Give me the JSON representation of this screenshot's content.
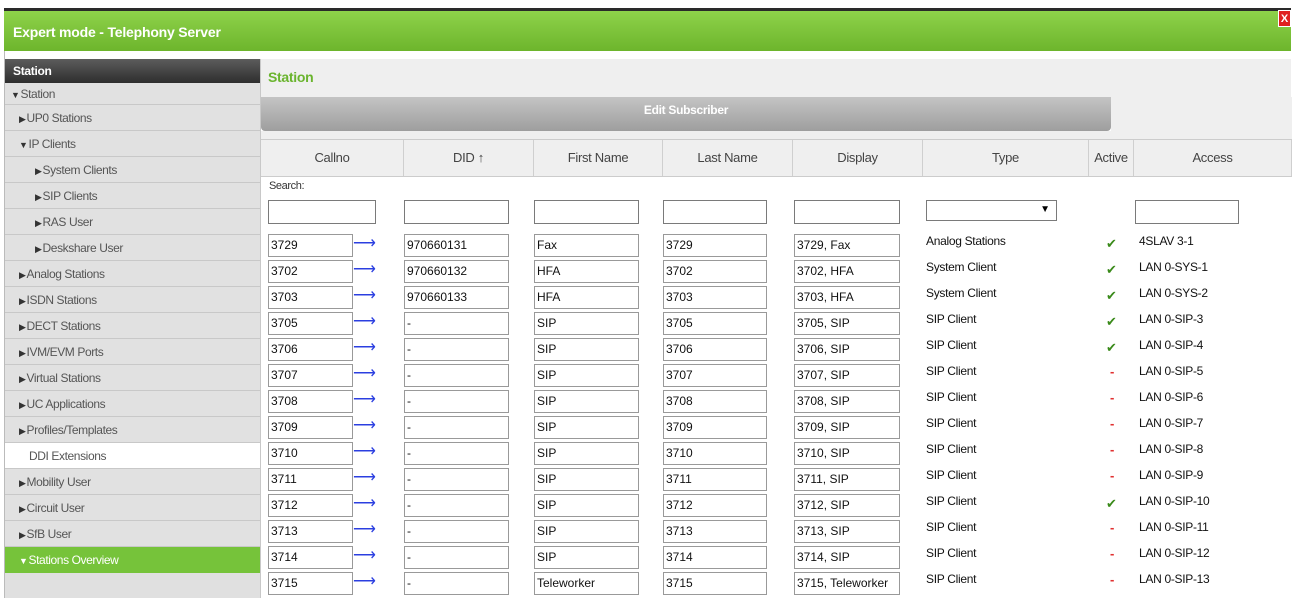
{
  "window": {
    "title": "Expert mode - Telephony Server",
    "close_label": "X"
  },
  "sidebar": {
    "header": "Station",
    "items": [
      {
        "label": "Station",
        "level": 0,
        "expanded": true
      },
      {
        "label": "UP0 Stations",
        "level": 1,
        "expanded": false
      },
      {
        "label": "IP Clients",
        "level": 1,
        "expanded": true
      },
      {
        "label": "System Clients",
        "level": 2,
        "expanded": false
      },
      {
        "label": "SIP Clients",
        "level": 2,
        "expanded": false
      },
      {
        "label": "RAS User",
        "level": 2,
        "expanded": false
      },
      {
        "label": "Deskshare User",
        "level": 2,
        "expanded": false
      },
      {
        "label": "Analog Stations",
        "level": 1,
        "expanded": false
      },
      {
        "label": "ISDN Stations",
        "level": 1,
        "expanded": false
      },
      {
        "label": "DECT Stations",
        "level": 1,
        "expanded": false
      },
      {
        "label": "IVM/EVM Ports",
        "level": 1,
        "expanded": false
      },
      {
        "label": "Virtual Stations",
        "level": 1,
        "expanded": false
      },
      {
        "label": "UC Applications",
        "level": 1,
        "expanded": false
      },
      {
        "label": "Profiles/Templates",
        "level": 1,
        "expanded": false
      },
      {
        "label": "DDI Extensions",
        "level": 1,
        "plain": true
      },
      {
        "label": "Mobility User",
        "level": 1,
        "expanded": false
      },
      {
        "label": "Circuit User",
        "level": 1,
        "expanded": false
      },
      {
        "label": "SfB User",
        "level": 1,
        "expanded": false
      },
      {
        "label": "Stations Overview",
        "level": 1,
        "expanded": true,
        "active": true
      }
    ]
  },
  "main": {
    "title": "Station",
    "section_title": "Edit Subscriber",
    "search_label": "Search:",
    "columns": [
      "Callno",
      "DID ↑",
      "First Name",
      "Last Name",
      "Display",
      "Type",
      "Active",
      "Access"
    ],
    "rows": [
      {
        "callno": "3729",
        "did": "970660131",
        "first": "Fax",
        "last": "3729",
        "display": "3729, Fax",
        "type": "Analog Stations",
        "active": true,
        "access": "4SLAV 3-1"
      },
      {
        "callno": "3702",
        "did": "970660132",
        "first": "HFA",
        "last": "3702",
        "display": "3702, HFA",
        "type": "System Client",
        "active": true,
        "access": "LAN 0-SYS-1"
      },
      {
        "callno": "3703",
        "did": "970660133",
        "first": "HFA",
        "last": "3703",
        "display": "3703, HFA",
        "type": "System Client",
        "active": true,
        "access": "LAN 0-SYS-2"
      },
      {
        "callno": "3705",
        "did": "-",
        "first": "SIP",
        "last": "3705",
        "display": "3705, SIP",
        "type": "SIP Client",
        "active": true,
        "access": "LAN 0-SIP-3"
      },
      {
        "callno": "3706",
        "did": "-",
        "first": "SIP",
        "last": "3706",
        "display": "3706, SIP",
        "type": "SIP Client",
        "active": true,
        "access": "LAN 0-SIP-4"
      },
      {
        "callno": "3707",
        "did": "-",
        "first": "SIP",
        "last": "3707",
        "display": "3707, SIP",
        "type": "SIP Client",
        "active": false,
        "access": "LAN 0-SIP-5"
      },
      {
        "callno": "3708",
        "did": "-",
        "first": "SIP",
        "last": "3708",
        "display": "3708, SIP",
        "type": "SIP Client",
        "active": false,
        "access": "LAN 0-SIP-6"
      },
      {
        "callno": "3709",
        "did": "-",
        "first": "SIP",
        "last": "3709",
        "display": "3709, SIP",
        "type": "SIP Client",
        "active": false,
        "access": "LAN 0-SIP-7"
      },
      {
        "callno": "3710",
        "did": "-",
        "first": "SIP",
        "last": "3710",
        "display": "3710, SIP",
        "type": "SIP Client",
        "active": false,
        "access": "LAN 0-SIP-8"
      },
      {
        "callno": "3711",
        "did": "-",
        "first": "SIP",
        "last": "3711",
        "display": "3711, SIP",
        "type": "SIP Client",
        "active": false,
        "access": "LAN 0-SIP-9"
      },
      {
        "callno": "3712",
        "did": "-",
        "first": "SIP",
        "last": "3712",
        "display": "3712, SIP",
        "type": "SIP Client",
        "active": true,
        "access": "LAN 0-SIP-10"
      },
      {
        "callno": "3713",
        "did": "-",
        "first": "SIP",
        "last": "3713",
        "display": "3713, SIP",
        "type": "SIP Client",
        "active": false,
        "access": "LAN 0-SIP-11"
      },
      {
        "callno": "3714",
        "did": "-",
        "first": "SIP",
        "last": "3714",
        "display": "3714, SIP",
        "type": "SIP Client",
        "active": false,
        "access": "LAN 0-SIP-12"
      },
      {
        "callno": "3715",
        "did": "-",
        "first": "Teleworker",
        "last": "3715",
        "display": "3715, Teleworker",
        "type": "SIP Client",
        "active": false,
        "access": "LAN 0-SIP-13"
      }
    ],
    "active_symbols": {
      "yes": "✔",
      "no": "-"
    },
    "arrow_symbol": "⟶"
  },
  "colors": {
    "accent": "#76c33a",
    "title_green": "#6ab42e",
    "link_blue": "#2b3fe0",
    "check_green": "#3a8a1a",
    "inactive_red": "#e03030"
  }
}
